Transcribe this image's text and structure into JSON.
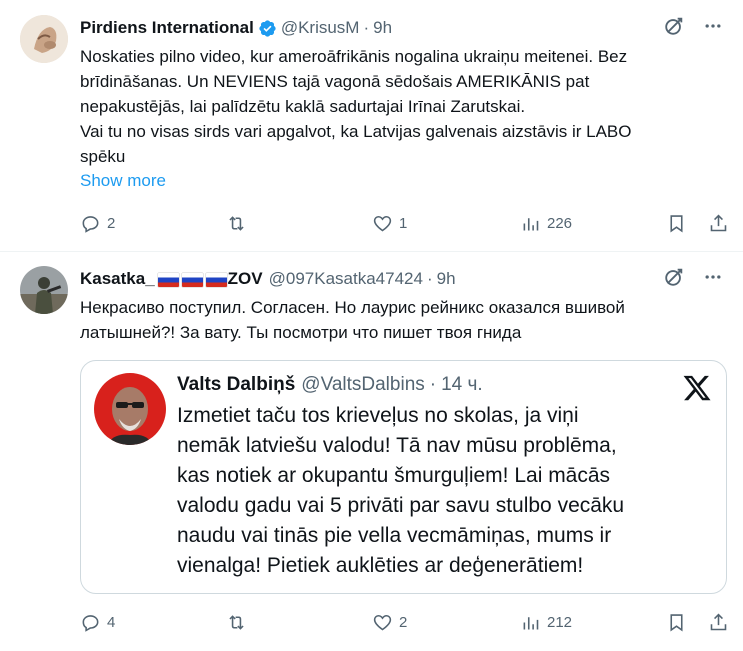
{
  "tweets": [
    {
      "author_name": "Pirdiens International",
      "verified": true,
      "handle": "@KrisusM",
      "separator": "·",
      "time": "9h",
      "body_lines": [
        "Noskaties pilno video, kur ameroāfrikānis nogalina ukraiņu meitenei. Bez",
        "brīdināšanas. Un NEVIENS tajā vagonā sēdošais AMERIKĀNIS pat",
        "nepakustējās, lai palīdzētu kaklā sadurtajai Irīnai Zarutskai.",
        "Vai tu no visas sirds vari apgalvot, ka Latvijas galvenais aizstāvis ir LABO",
        "spēku"
      ],
      "show_more": "Show more",
      "counts": {
        "replies": "2",
        "reposts": "",
        "likes": "1",
        "views": "226"
      }
    },
    {
      "author_name": "Kasatka_",
      "author_suffix": "ZOV",
      "handle": "@097Kasatka47424",
      "separator": "·",
      "time": "9h",
      "body_lines": [
        "Некрасиво поступил. Согласен. Но лаурис рейникс оказался вшивой",
        "латышней?! За вату. Ты посмотри что пишет твоя гнида"
      ],
      "counts": {
        "replies": "4",
        "reposts": "",
        "likes": "2",
        "views": "212"
      },
      "quoted": {
        "author_name": "Valts Dalbiņš",
        "handle": "@ValtsDalbins",
        "separator": "·",
        "time": "14 ч.",
        "lines": [
          "Izmetiet taču tos krieveļus no skolas, ja viņi",
          "nemāk latviešu valodu! Tā nav mūsu problēma,",
          "kas notiek ar okupantu šmurguļiem! Lai mācās",
          "valodu gadu vai 5 privāti par savu stulbo vecāku",
          "naudu vai tinās pie vella vecmāmiņas, mums ir",
          "vienalga! Pietiek auklēties ar deģenerātiem!"
        ]
      }
    }
  ],
  "colors": {
    "text": "#0f1419",
    "secondary": "#536471",
    "link": "#1d9bf0",
    "verified": "#1d9bf0",
    "border": "#cfd9de"
  },
  "icons": [
    "verified-badge-icon",
    "grok-icon",
    "more-icon",
    "reply-icon",
    "repost-icon",
    "like-icon",
    "views-icon",
    "bookmark-icon",
    "share-icon",
    "x-logo-icon",
    "russian-flag-icon"
  ]
}
